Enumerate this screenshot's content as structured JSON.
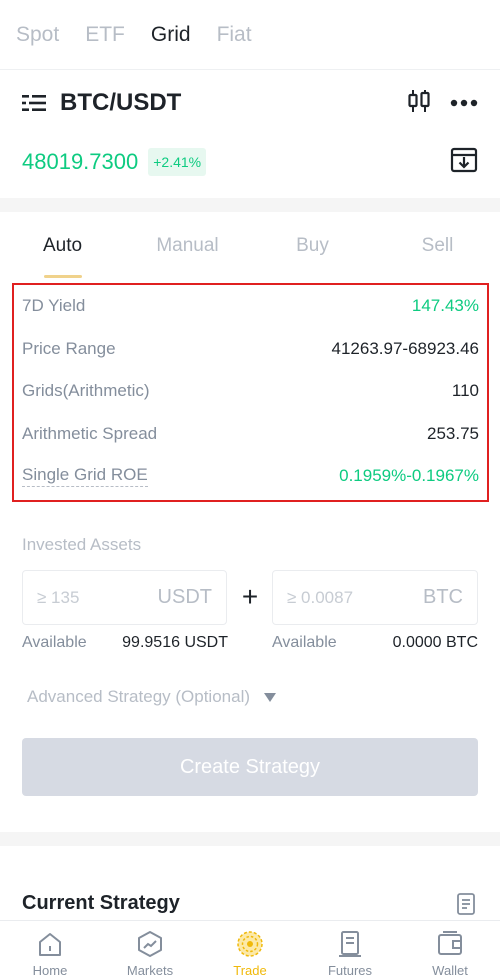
{
  "top_tabs": [
    "Spot",
    "ETF",
    "Grid",
    "Fiat"
  ],
  "pair": {
    "title": "BTC/USDT",
    "price": "48019.7300",
    "change": "+2.41%"
  },
  "mode_tabs": [
    "Auto",
    "Manual",
    "Buy",
    "Sell"
  ],
  "stats": [
    {
      "label": "7D Yield",
      "value": "147.43%"
    },
    {
      "label": "Price Range",
      "value": "41263.97-68923.46"
    },
    {
      "label": "Grids(Arithmetic)",
      "value": "110"
    },
    {
      "label": "Arithmetic Spread",
      "value": "253.75"
    },
    {
      "label": "Single Grid ROE",
      "value": "0.1959%-0.1967%"
    }
  ],
  "invested": {
    "label": "Invested Assets",
    "usdt_placeholder": "≥ 135",
    "usdt_unit": "USDT",
    "btc_placeholder": "≥ 0.0087",
    "btc_unit": "BTC",
    "plus": "+",
    "available_label": "Available",
    "usdt_available": "99.9516 USDT",
    "btc_available": "0.0000 BTC"
  },
  "advanced_label": "Advanced Strategy (Optional)",
  "create_button": "Create Strategy",
  "current_strategy_title": "Current Strategy",
  "bottom_nav": [
    {
      "label": "Home",
      "icon": "home-icon"
    },
    {
      "label": "Markets",
      "icon": "markets-icon"
    },
    {
      "label": "Trade",
      "icon": "trade-icon"
    },
    {
      "label": "Futures",
      "icon": "futures-icon"
    },
    {
      "label": "Wallet",
      "icon": "wallet-icon"
    }
  ],
  "colors": {
    "green": "#0ecb81",
    "accent": "#f0b90b",
    "highlight_border": "#e02020"
  }
}
